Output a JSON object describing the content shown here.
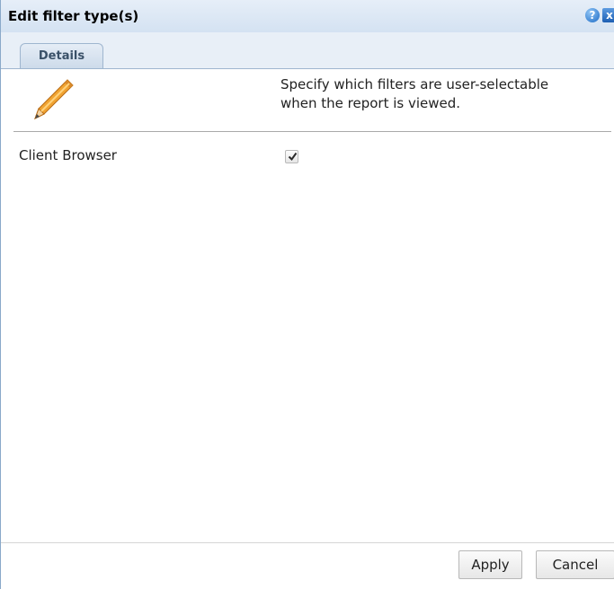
{
  "dialog": {
    "title": "Edit filter type(s)",
    "help_icon": "question-mark-icon",
    "close_icon": "close-icon",
    "help_glyph": "?",
    "close_glyph": "x"
  },
  "tabs": [
    {
      "label": "Details",
      "active": true
    }
  ],
  "header": {
    "icon": "pencil-icon",
    "description": "Specify which filters are user-selectable\nwhen the report is viewed."
  },
  "filters": [
    {
      "label": "Client Browser",
      "checked": true
    }
  ],
  "footer": {
    "apply_label": "Apply",
    "cancel_label": "Cancel"
  },
  "colors": {
    "titlebar": "#d4e2f2",
    "tab_text": "#3a5168",
    "accent": "#1e6cc6"
  }
}
